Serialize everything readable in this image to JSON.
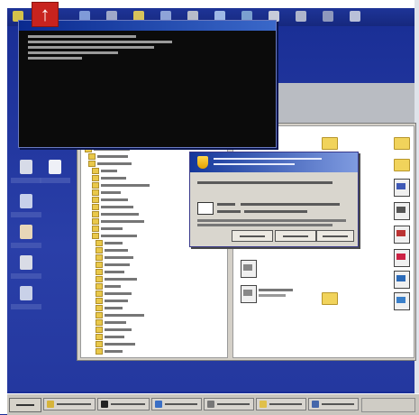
{
  "badge": {
    "glyph": "↑"
  },
  "colors": {
    "desktop": "#1b2f98",
    "badge": "#c8231e",
    "console": "#0b0b0b",
    "titlebar": "#14379a",
    "folder": "#f1d35b",
    "taskbar": "#c9c6bf"
  },
  "icons": {
    "topbar": [
      "app-icon",
      "globe-icon",
      "gear-icon",
      "folder-icon",
      "monitor-icon",
      "printer-icon",
      "mail-icon",
      "network-icon",
      "window-icon",
      "search-icon",
      "disk-icon",
      "help-icon"
    ],
    "desktop": [
      "recycle-bin-icon",
      "document-icon",
      "network-icon",
      "user-icon",
      "printer-icon",
      "drive-icon"
    ],
    "taskbar": [
      "start-icon",
      "explorer-icon",
      "console-icon",
      "browser-icon",
      "settings-icon",
      "folder-icon",
      "window-icon",
      "network-icon"
    ]
  }
}
